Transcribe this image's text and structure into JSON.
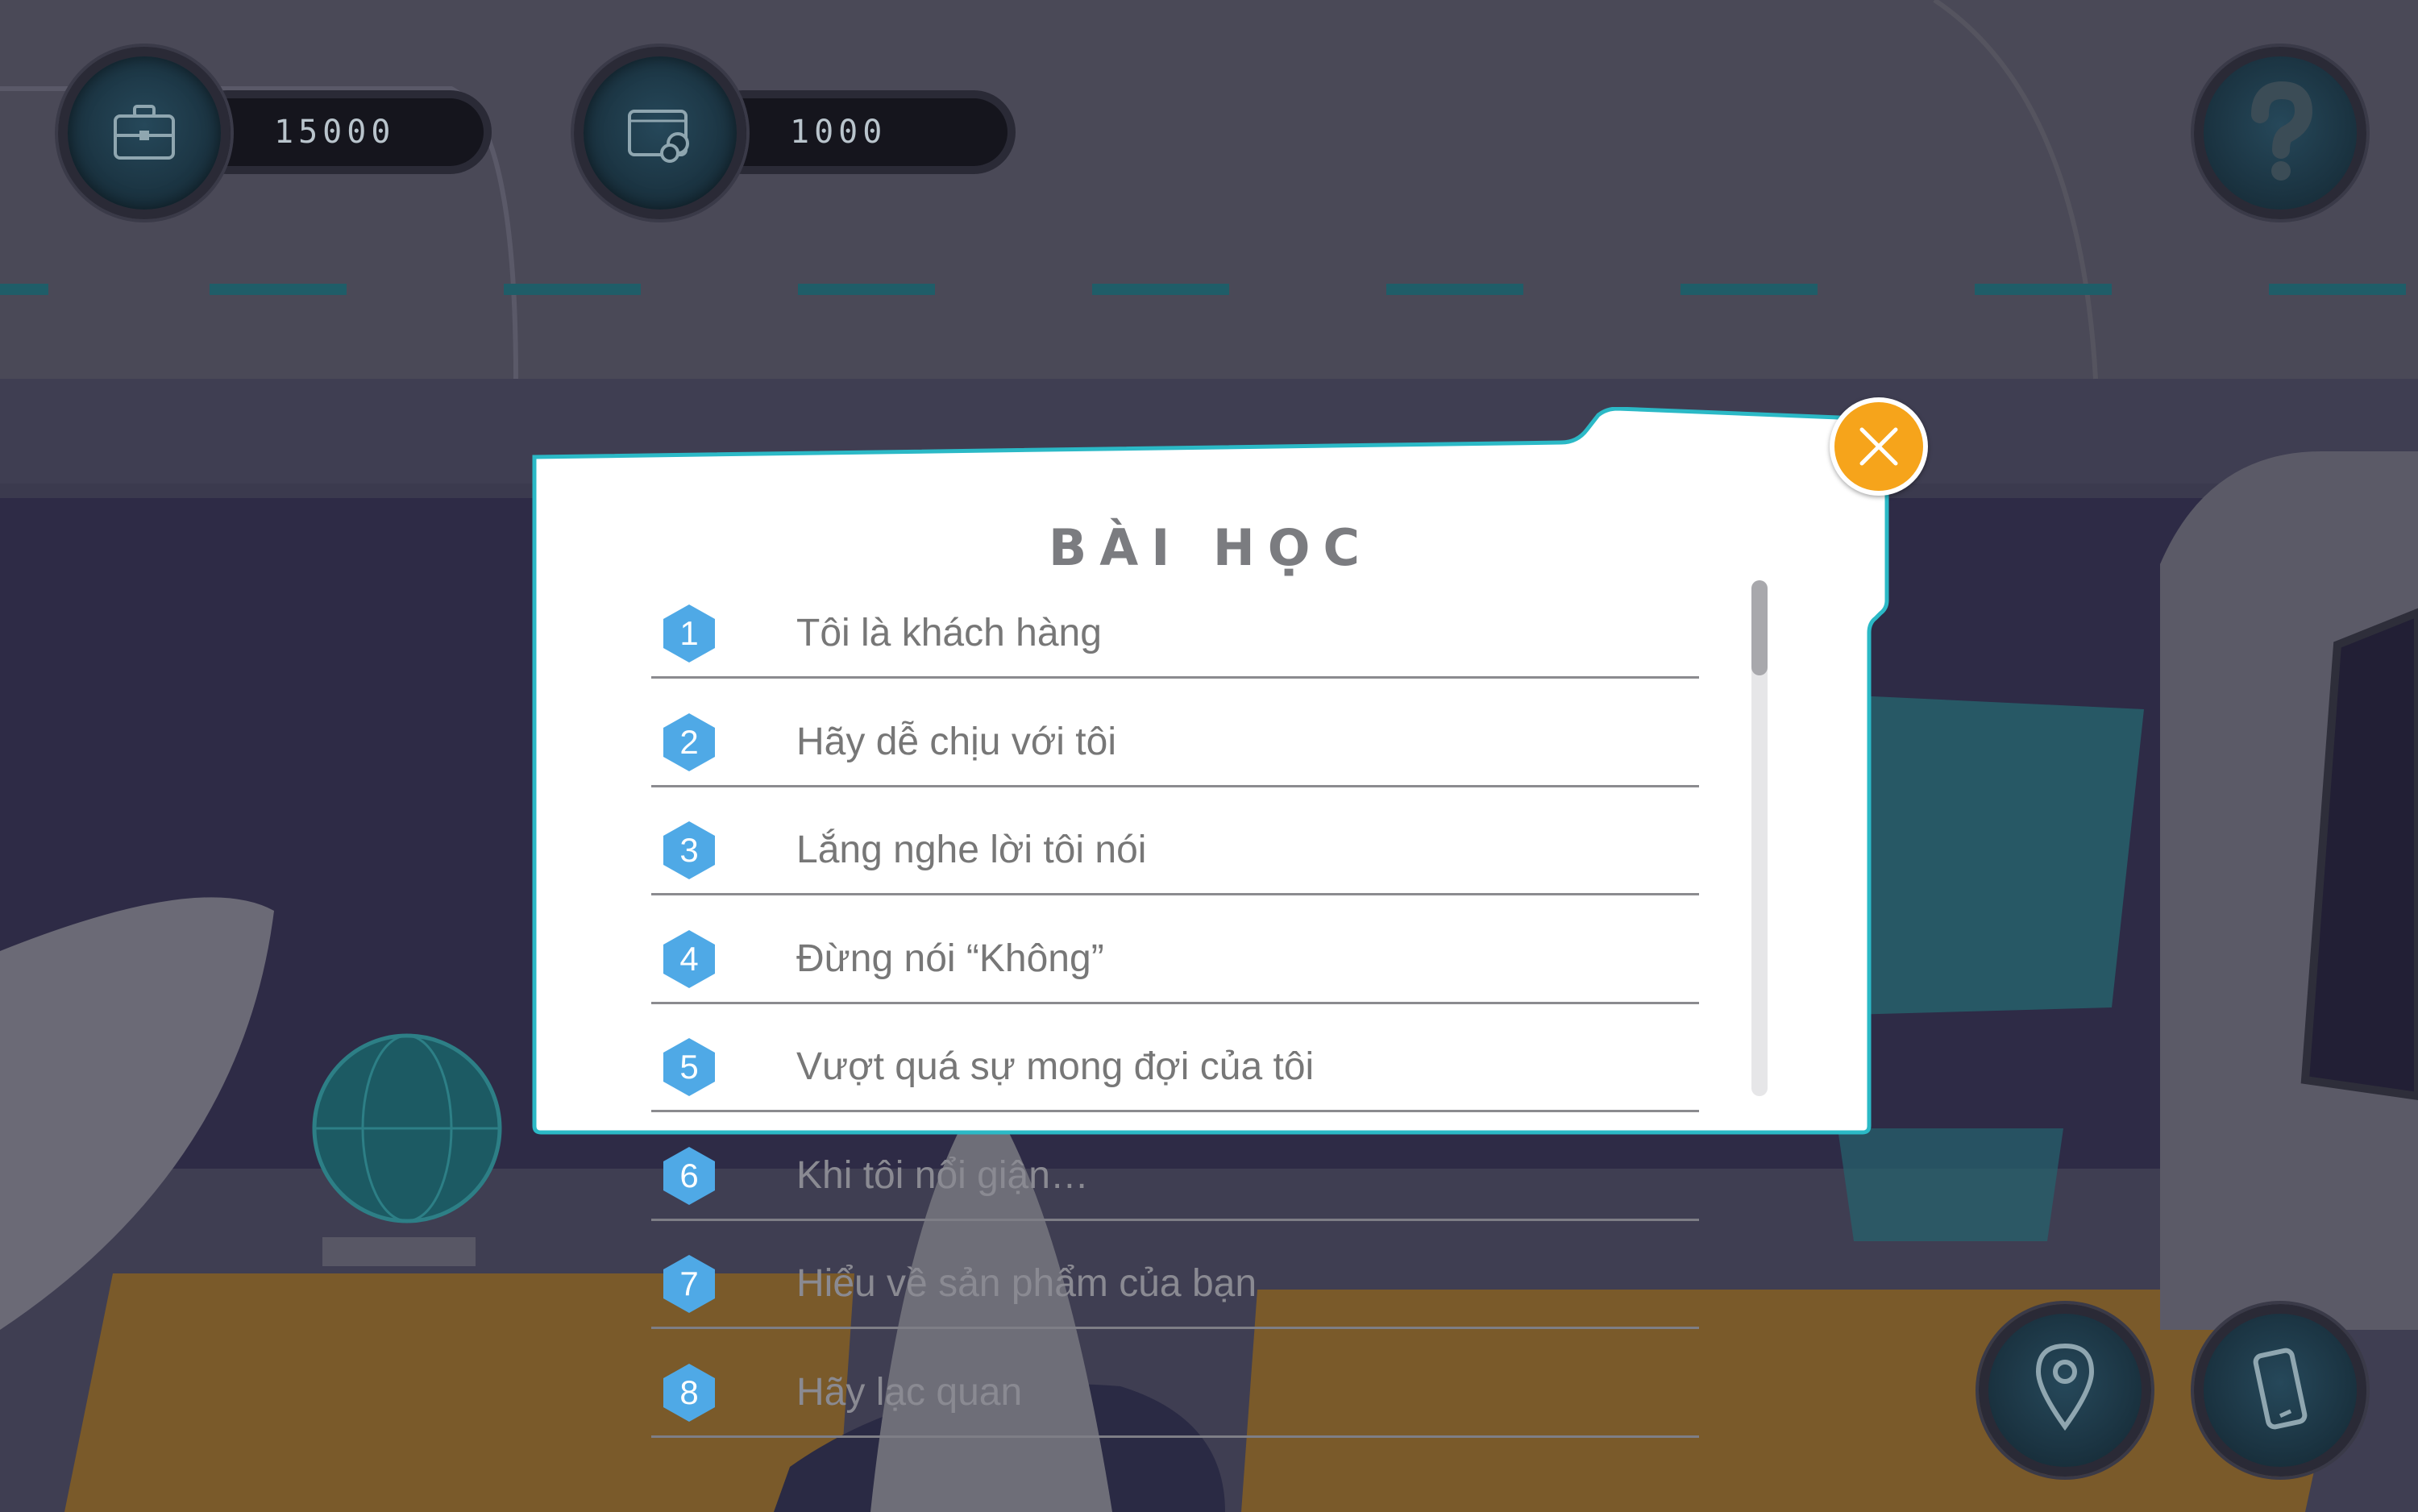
{
  "hud": {
    "money_value": "15000",
    "wallet_value": "1000",
    "money_icon": "briefcase-icon",
    "wallet_icon": "wallet-coins-icon",
    "help_icon": "question-mark-icon"
  },
  "modal": {
    "title": "BÀI HỌC",
    "close_icon": "close-x-icon",
    "lessons": [
      {
        "number": "1",
        "title": "Tôi là khách hàng"
      },
      {
        "number": "2",
        "title": "Hãy dễ chịu với tôi"
      },
      {
        "number": "3",
        "title": "Lắng nghe lời tôi nói"
      },
      {
        "number": "4",
        "title": "Đừng nói “Không”"
      },
      {
        "number": "5",
        "title": "Vượt quá sự mong đợi của tôi"
      },
      {
        "number": "6",
        "title": "Khi tôi nổi giận…"
      },
      {
        "number": "7",
        "title": "Hiểu về sản phẩm của bạn"
      },
      {
        "number": "8",
        "title": "Hãy lạc quan"
      }
    ]
  },
  "bottom_buttons": {
    "map_icon": "map-pin-icon",
    "phone_icon": "smartphone-icon"
  },
  "colors": {
    "accent_orange": "#f6a41b",
    "number_badge_blue": "#4fa9e6",
    "modal_border_teal": "#2bb9c6",
    "title_gray": "#7b7c80"
  }
}
